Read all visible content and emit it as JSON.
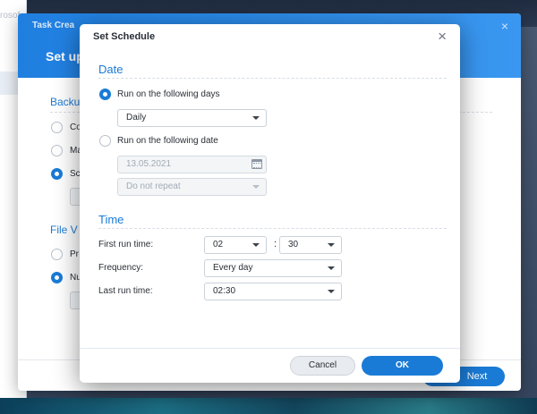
{
  "background": {
    "left_window_title_fragment": "rosof",
    "wizard": {
      "title": "Task Crea",
      "heading": "Set up",
      "section_backup": "Backu",
      "section_file_version": "File V",
      "radio_labels": [
        "Co",
        "Ma",
        "Sc",
        "Pr",
        "Nu"
      ],
      "next_label": "Next",
      "close_glyph": "×"
    }
  },
  "modal": {
    "title": "Set Schedule",
    "close_glyph": "×",
    "date_section": {
      "title": "Date",
      "option_days_label": "Run on the following days",
      "option_days_selected": true,
      "days_select_value": "Daily",
      "option_date_label": "Run on the following date",
      "option_date_selected": false,
      "date_input_value": "13.05.2021",
      "repeat_select_value": "Do not repeat"
    },
    "time_section": {
      "title": "Time",
      "first_run_label": "First run time:",
      "first_run_hour": "02",
      "time_separator": ":",
      "first_run_minute": "30",
      "frequency_label": "Frequency:",
      "frequency_value": "Every day",
      "last_run_label": "Last run time:",
      "last_run_value": "02:30"
    },
    "buttons": {
      "cancel_label": "Cancel",
      "ok_label": "OK"
    }
  },
  "colors": {
    "accent": "#1a7bd6",
    "wizard_header": "#2b8ae8"
  }
}
